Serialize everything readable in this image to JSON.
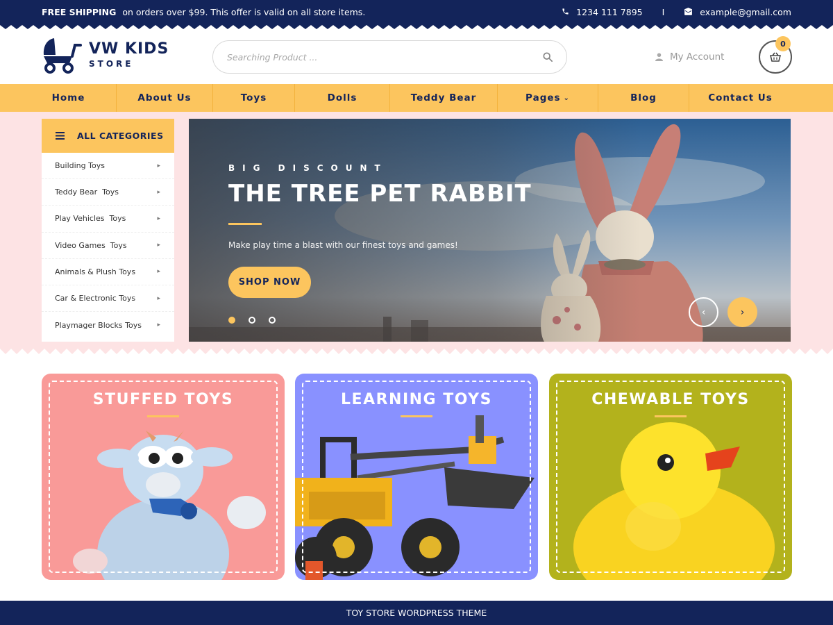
{
  "topbar": {
    "shipping_bold": "FREE SHIPPING",
    "shipping_text": "on orders over $99. This offer is valid on all store items.",
    "phone": "1234 111 7895",
    "separator": "I",
    "email": "example@gmail.com"
  },
  "logo": {
    "title": "VW KIDS",
    "subtitle": "STORE"
  },
  "search": {
    "placeholder": "Searching Product ..."
  },
  "account": {
    "label": "My Account"
  },
  "cart": {
    "count": "0"
  },
  "nav": {
    "items": [
      {
        "label": "Home"
      },
      {
        "label": "About Us"
      },
      {
        "label": "Toys"
      },
      {
        "label": "Dolls"
      },
      {
        "label": "Teddy Bear"
      },
      {
        "label": "Pages",
        "caret": "⌄"
      },
      {
        "label": "Blog"
      },
      {
        "label": "Contact Us"
      }
    ]
  },
  "categories": {
    "heading": "ALL CATEGORIES",
    "items": [
      "Building Toys",
      "Teddy Bear  Toys",
      "Play Vehicles  Toys",
      "Video Games  Toys",
      "Animals & Plush Toys",
      "Car & Electronic Toys",
      "Playmager Blocks Toys"
    ]
  },
  "slider": {
    "eyebrow": "BIG DISCOUNT",
    "title": "THE TREE PET RABBIT",
    "description": "Make play time a blast with our finest toys and games!",
    "button": "SHOP NOW",
    "active_dot": 1,
    "dot_count": 3
  },
  "cards": [
    {
      "title": "STUFFED TOYS",
      "color": "#f99a98"
    },
    {
      "title": "LEARNING TOYS",
      "color": "#8991ff"
    },
    {
      "title": "CHEWABLE TOYS",
      "color": "#b3b21c"
    }
  ],
  "footer": {
    "text": "TOY STORE WORDPRESS THEME"
  },
  "colors": {
    "navy": "#13245a",
    "yellow": "#fcc55e",
    "pink_band": "#fde3e4"
  }
}
